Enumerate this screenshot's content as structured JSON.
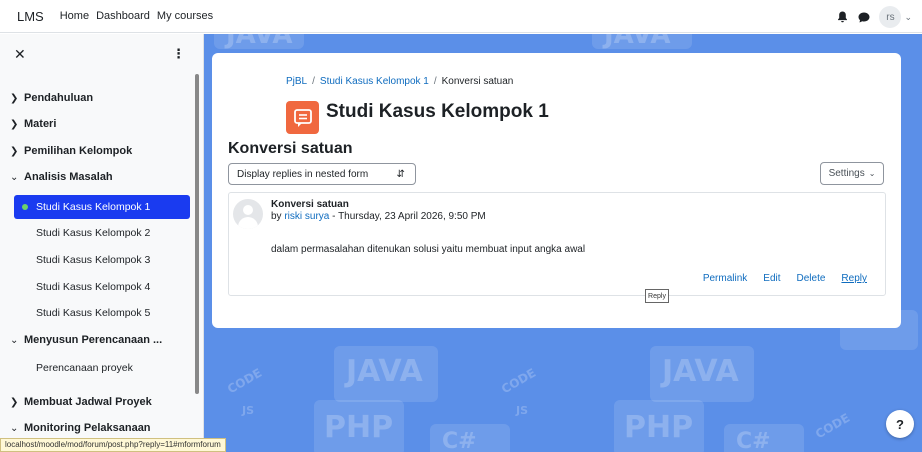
{
  "navbar": {
    "brand": "LMS",
    "links": [
      "Home",
      "Dashboard",
      "My courses"
    ],
    "avatar_initials": "rs"
  },
  "drawer": {
    "sections": [
      {
        "label": "Pendahuluan",
        "expanded": false
      },
      {
        "label": "Materi",
        "expanded": false
      },
      {
        "label": "Pemilihan Kelompok",
        "expanded": false
      },
      {
        "label": "Analisis Masalah",
        "expanded": true
      },
      {
        "label": "Menyusun Perencanaan ...",
        "expanded": true
      },
      {
        "label": "Membuat Jadwal Proyek",
        "expanded": false
      },
      {
        "label": "Monitoring Pelaksanaan",
        "expanded": true
      }
    ],
    "activities": [
      "Studi Kasus Kelompok 1",
      "Studi Kasus Kelompok 2",
      "Studi Kasus Kelompok 3",
      "Studi Kasus Kelompok 4",
      "Studi Kasus Kelompok 5",
      "Perencanaan proyek"
    ]
  },
  "status_url": "localhost/moodle/mod/forum/post.php?reply=11#mformforum",
  "breadcrumb": [
    "PjBL",
    "Studi Kasus Kelompok 1",
    "Konversi satuan"
  ],
  "page_title": "Studi Kasus Kelompok 1",
  "discussion_title": "Konversi satuan",
  "display_mode": "Display replies in nested form",
  "settings_label": "Settings",
  "post": {
    "subject": "Konversi satuan",
    "by_prefix": "by",
    "author": "riski surya",
    "date": " - Thursday, 23 April 2026, 9:50 PM",
    "body": "dalam permasalahan ditenukan solusi yaitu membuat input angka awal",
    "actions": [
      "Permalink",
      "Edit",
      "Delete",
      "Reply"
    ]
  },
  "tooltip": "Reply",
  "background_words": [
    "JAVA",
    "PHP",
    "CODE",
    "JS",
    "C#"
  ],
  "help_label": "?",
  "colors": {
    "accent": "#1a3bf0",
    "background": "#5b8fe8",
    "forum_icon": "#f0683f",
    "link": "#0f6cbf"
  }
}
